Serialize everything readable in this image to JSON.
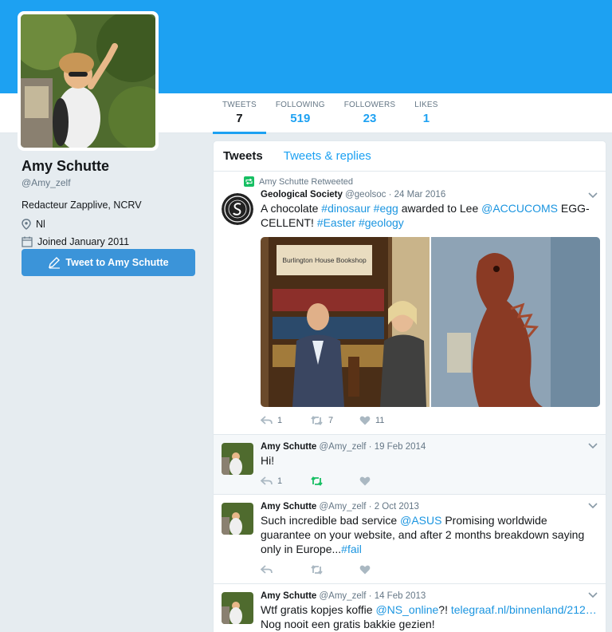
{
  "colors": {
    "accent": "#1da1f2",
    "retweet": "#17bf63",
    "muted": "#657786"
  },
  "nav": {
    "stats": [
      {
        "label": "TWEETS",
        "value": "7"
      },
      {
        "label": "FOLLOWING",
        "value": "519"
      },
      {
        "label": "FOLLOWERS",
        "value": "23"
      },
      {
        "label": "LIKES",
        "value": "1"
      }
    ]
  },
  "profile": {
    "name": "Amy Schutte",
    "handle": "@Amy_zelf",
    "bio": "Redacteur Zapplive, NCRV",
    "location": "Nl",
    "joined": "Joined January 2011",
    "tweet_to_label": "Tweet to Amy Schutte",
    "location_icon": "location-pin-icon",
    "calendar_icon": "calendar-icon"
  },
  "timeline": {
    "tabs": [
      "Tweets",
      "Tweets & replies"
    ],
    "tweets": [
      {
        "retweeted_by": "Amy Schutte Retweeted",
        "name": "Geological Society",
        "handle": "@geolsoc",
        "date": "· 24 Mar 2016",
        "text_parts": [
          "A chocolate ",
          "#dinosaur",
          " ",
          "#egg",
          " awarded to Lee ",
          "@ACCUCOMS",
          " EGG-CELLENT! ",
          "#Easter",
          " ",
          "#geology"
        ],
        "image_sign": "Burlington House Bookshop",
        "replies": "1",
        "retweets": "7",
        "likes": "11"
      },
      {
        "name": "Amy Schutte",
        "handle": "@Amy_zelf",
        "date": "· 19 Feb 2014",
        "text": "Hi!",
        "replies": "1"
      },
      {
        "name": "Amy Schutte",
        "handle": "@Amy_zelf",
        "date": "· 2 Oct 2013",
        "text_parts": [
          "Such incredible bad service ",
          "@ASUS",
          " Promising worldwide guarantee on your website, and after 2 months breakdown saying only in Europe...",
          "#fail"
        ]
      },
      {
        "name": "Amy Schutte",
        "handle": "@Amy_zelf",
        "date": "· 14 Feb 2013",
        "text_parts": [
          "Wtf gratis kopjes koffie ",
          "@NS_online",
          "?! ",
          "telegraaf.nl/binnenland/212…",
          " Nog nooit een gratis bakkie gezien!"
        ]
      }
    ]
  }
}
